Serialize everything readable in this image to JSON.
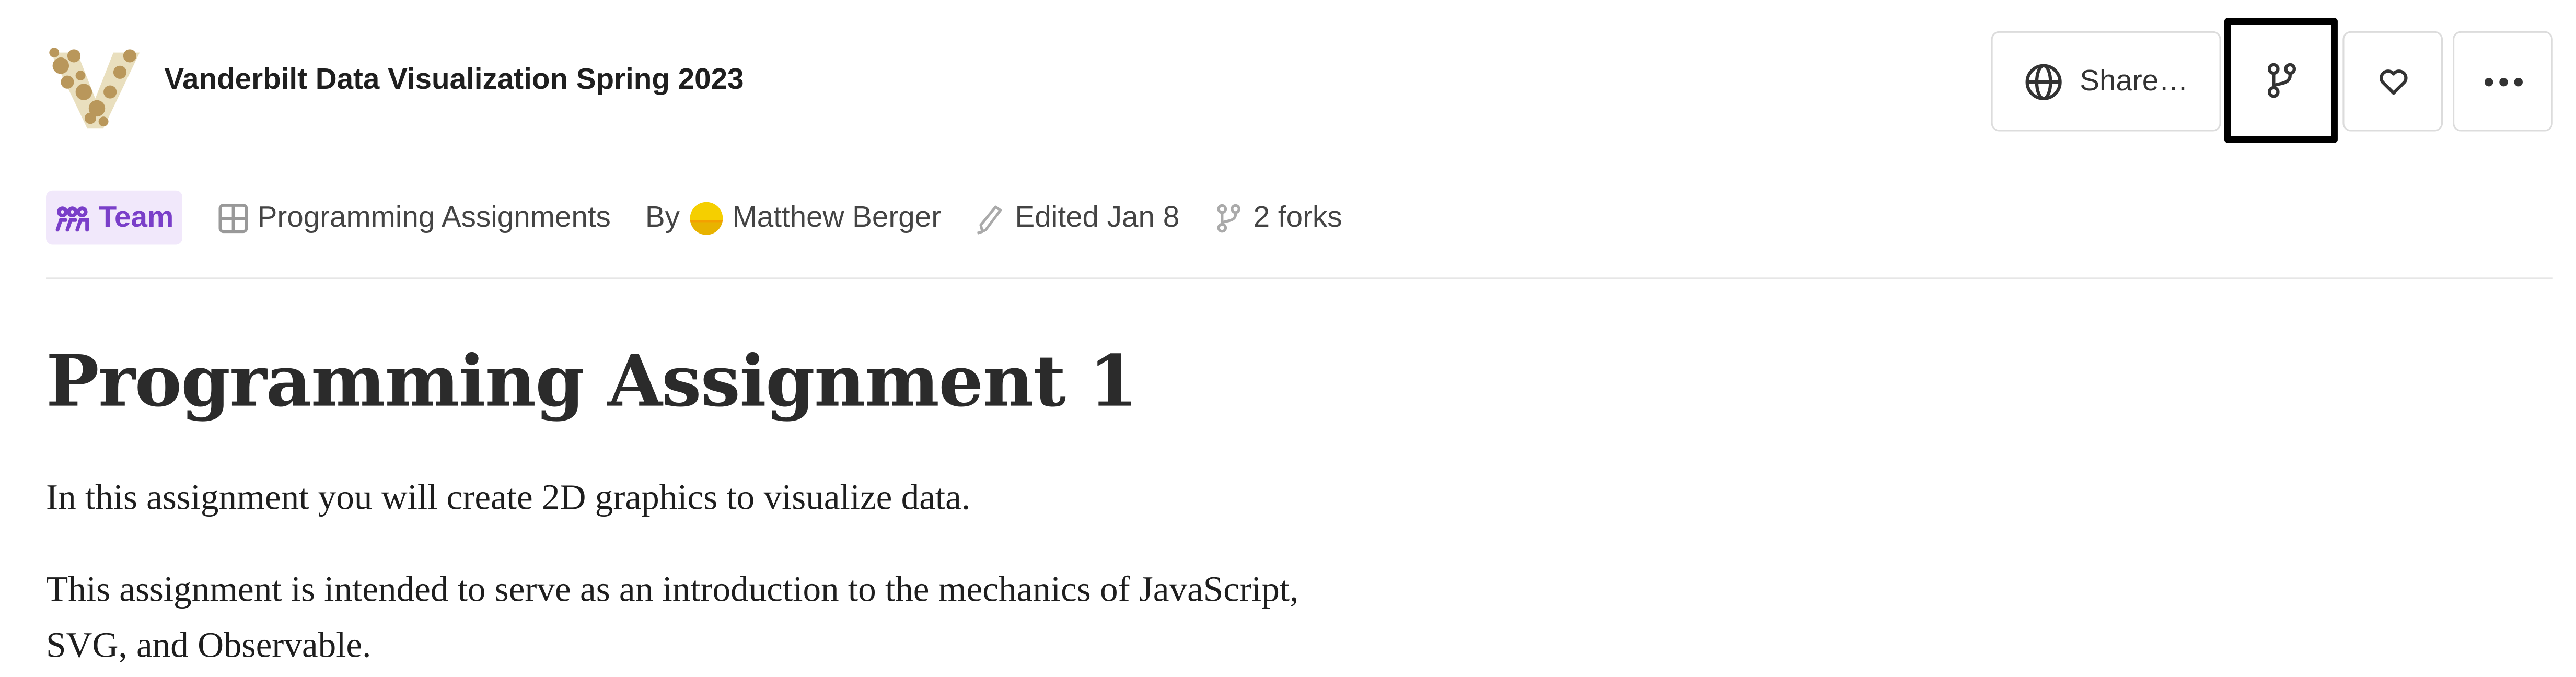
{
  "header": {
    "notebook_title": "Vanderbilt Data Visualization Spring 2023",
    "logo_icon": "vanderbilt-v-logo",
    "share_label": "Share…",
    "buttons": [
      {
        "name": "share",
        "icon": "globe-icon"
      },
      {
        "name": "fork",
        "icon": "fork-icon"
      },
      {
        "name": "like",
        "icon": "heart-icon"
      },
      {
        "name": "more",
        "icon": "more-horizontal-icon"
      }
    ]
  },
  "meta": {
    "team_label": "Team",
    "collection_label": "Programming Assignments",
    "by_label": "By",
    "author": "Matthew Berger",
    "edited": "Edited Jan 8",
    "forks": "2 forks"
  },
  "content": {
    "heading": "Programming Assignment 1",
    "paragraphs": [
      "In this assignment you will create 2D graphics to visualize data.",
      "This assignment is intended to serve as an introduction to the mechanics of JavaScript, SVG, and Observable."
    ]
  },
  "colors": {
    "team_accent": "#7a3fc9",
    "team_background": "#f1e8fb",
    "logo_gold": "#b9975b"
  }
}
